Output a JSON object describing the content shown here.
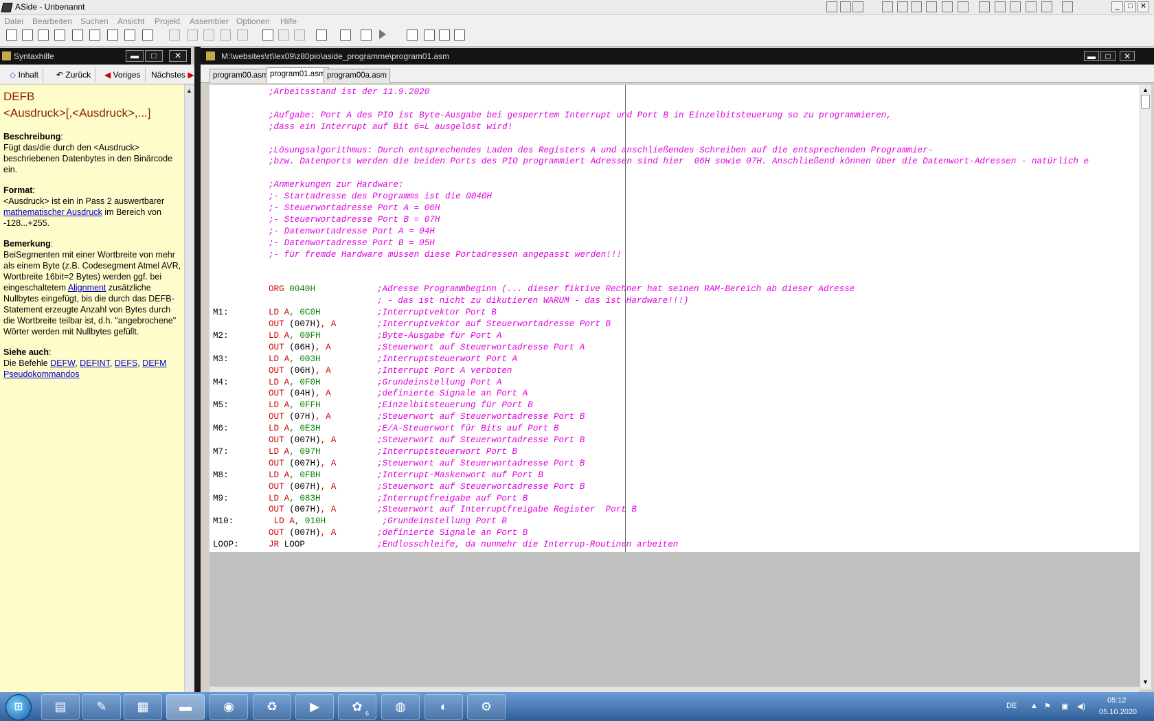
{
  "window": {
    "title": "ASide - Unbenannt"
  },
  "menu": [
    "Datei",
    "Bearbeiten",
    "Suchen",
    "Ansicht",
    "Projekt",
    "Assembler",
    "Optionen",
    "Hilfe"
  ],
  "quicklaunch": [
    "ie-icon",
    "help-icon",
    "help2-icon",
    "mail-icon",
    "doc-icon",
    "note-icon",
    "card-icon",
    "people-icon",
    "pen-icon",
    "word-icon",
    "excel-icon",
    "access-icon",
    "clock-icon",
    "book-icon",
    "app-icon"
  ],
  "help_panel": {
    "title": "Syntaxhilfe",
    "nav": {
      "contents": "Inhalt",
      "back": "Zurück",
      "prev": "Voriges",
      "next": "Nächstes"
    },
    "heading_line1": "DEFB",
    "heading_line2": "<Ausdruck>[,<Ausdruck>,...]",
    "desc_label": "Beschreibung",
    "desc_text": "Fügt das/die durch den <Ausdruck> beschriebenen Datenbytes in den Binärcode ein.",
    "format_label": "Format",
    "format_pre": "<Ausdruck> ist ein in Pass 2 auswertbarer ",
    "format_link": "mathematischer Ausdruck",
    "format_post": " im Bereich von -128...+255.",
    "remark_label": "Bemerkung",
    "remark_pre": "BeiSegmenten mit einer Wortbreite von mehr als einem Byte (z.B. Codesegment Atmel AVR, Wortbreite 16bit=2 Bytes) werden ggf. bei eingeschaltetem ",
    "remark_link": "Alignment",
    "remark_post": " zusätzliche Nullbytes eingefügt, bis die durch das DEFB-Statement erzeugte Anzahl von Bytes durch die Wortbreite teilbar ist, d.h. \"angebrochene\" Wörter werden mit Nullbytes gefüllt.",
    "seealso_label": "Siehe auch",
    "seealso_pre": "Die Befehle ",
    "seealso_links": [
      "DEFW",
      "DEFINT",
      "DEFS",
      "DEFM"
    ],
    "seealso_link2": "Pseudokommandos"
  },
  "editor": {
    "path": "M:\\websites\\rt\\lex09\\z80pio\\aside_programme\\program01.asm",
    "tabs": [
      "program00.asm",
      "program01.asm",
      "program00a.asm"
    ],
    "active_tab": 1,
    "lines": [
      {
        "c": ";Arbeitsstand ist der 11.9.2020",
        "ci": 1
      },
      {},
      {
        "c": ";Aufgabe: Port A des PIO ist Byte-Ausgabe bei gesperrtem Interrupt und Port B in Einzelbitsteuerung so zu programmieren,",
        "ci": 1
      },
      {
        "c": ";dass ein Interrupt auf Bit 6=L ausgelöst wird!",
        "ci": 1
      },
      {},
      {
        "c": ";Lösungsalgorithmus: Durch entsprechendes Laden des Registers A und anschließendes Schreiben auf die entsprechenden Programmier-",
        "ci": 1
      },
      {
        "c": ";bzw. Datenports werden die beiden Ports des PIO programmiert Adressen sind hier  06H sowie 07H. Anschließend können über die Datenwort-Adressen - natürlich e",
        "ci": 1
      },
      {},
      {
        "c": ";Anmerkungen zur Hardware:",
        "ci": 1
      },
      {
        "c": ";- Startadresse des Programms ist die 0040H",
        "ci": 1
      },
      {
        "c": ";- Steuerwortadresse Port A = 06H",
        "ci": 1
      },
      {
        "c": ";- Steuerwortadresse Port B = 07H",
        "ci": 1
      },
      {
        "c": ";- Datenwortadresse Port A = 04H",
        "ci": 1
      },
      {
        "c": ";- Datenwortadresse Port B = 05H",
        "ci": 1
      },
      {
        "c": ";- für fremde Hardware müssen diese Portadressen angepasst werden!!!",
        "ci": 1
      },
      {},
      {},
      {
        "op": "ORG",
        "a1": " 0040H",
        "c": ";Adresse Programmbeginn (... dieser fiktive Rechner hat seinen RAM-Bereich ab dieser Adresse"
      },
      {
        "c": "; - das ist nicht zu dikutieren WARUM - das ist Hardware!!!)"
      },
      {
        "l": "M1:",
        "op": "LD",
        "r": " A",
        "a2": ", 0C0H",
        "c": ";Interruptvektor Port B"
      },
      {
        "op": "OUT",
        "a1": " (007H)",
        "r2": ", A",
        "c": ";Interruptvektor auf Steuerwortadresse Port B"
      },
      {
        "l": "M2:",
        "op": "LD",
        "r": " A",
        "a2": ", 00FH",
        "c": ";Byte-Ausgabe für Port A"
      },
      {
        "op": "OUT",
        "a1": " (06H)",
        "r2": ", A",
        "c": ";Steuerwort auf Steuerwortadresse Port A"
      },
      {
        "l": "M3:",
        "op": "LD",
        "r": " A",
        "a2": ", 003H",
        "c": ";Interruptsteuerwort Port A"
      },
      {
        "op": "OUT",
        "a1": " (06H)",
        "r2": ", A",
        "c": ";Interrupt Port A verboten"
      },
      {
        "l": "M4:",
        "op": "LD",
        "r": " A",
        "a2": ", 0F0H",
        "c": ";Grundeinstellung Port A"
      },
      {
        "op": "OUT",
        "a1": " (04H)",
        "r2": ", A",
        "c": ";definierte Signale an Port A"
      },
      {
        "l": "M5:",
        "op": "LD",
        "r": " A",
        "a2": ", 0FFH",
        "c": ";Einzelbitsteuerung für Port B"
      },
      {
        "op": "OUT",
        "a1": " (07H)",
        "r2": ", A",
        "c": ";Steuerwort auf Steuerwortadresse Port B"
      },
      {
        "l": "M6:",
        "op": "LD",
        "r": " A",
        "a2": ", 0E3H",
        "c": ";E/A-Steuerwort für Bits auf Port B"
      },
      {
        "op": "OUT",
        "a1": " (007H)",
        "r2": ", A",
        "c": ";Steuerwort auf Steuerwortadresse Port B"
      },
      {
        "l": "M7:",
        "op": "LD",
        "r": " A",
        "a2": ", 097H",
        "c": ";Interruptsteuerwort Port B"
      },
      {
        "op": "OUT",
        "a1": " (007H)",
        "r2": ", A",
        "c": ";Steuerwort auf Steuerwortadresse Port B"
      },
      {
        "l": "M8:",
        "op": "LD",
        "r": " A",
        "a2": ", 0FBH",
        "c": ";Interrupt-Maskenwort auf Port B"
      },
      {
        "op": "OUT",
        "a1": " (007H)",
        "r2": ", A",
        "c": ";Steuerwort auf Steuerwortadresse Port B"
      },
      {
        "l": "M9:",
        "op": "LD",
        "r": " A",
        "a2": ", 083H",
        "c": ";Interruptfreigabe auf Port B"
      },
      {
        "op": "OUT",
        "a1": " (007H)",
        "r2": ", A",
        "c": ";Steuerwort auf Interruptfreigabe Register  Port B"
      },
      {
        "l": "M10:",
        "op": " LD",
        "r": " A",
        "a2": ", 010H",
        "c": " ;Grundeinstellung Port B"
      },
      {
        "op": "OUT",
        "a1": " (007H)",
        "r2": ", A",
        "c": ";definierte Signale an Port B"
      },
      {
        "l": "LOOP:",
        "op": "JR",
        "a1": " LOOP",
        "c": ";Endlosschleife, da nunmehr die Interrup-Routinen arbeiten"
      }
    ]
  },
  "taskbar": {
    "items": [
      "explorer-icon",
      "notepad-icon",
      "calculator-icon",
      "aside-icon",
      "globe-icon",
      "winamp-icon",
      "media-icon",
      "paint-icon",
      "chrome-icon",
      "edge-icon",
      "game-icon"
    ],
    "badge": "6",
    "lang": "DE",
    "time": "05:12",
    "date": "05.10.2020"
  },
  "colors": {
    "comment": "#e000e0",
    "keyword": "#d00000",
    "number": "#008000",
    "help_bg": "#fffccc"
  }
}
